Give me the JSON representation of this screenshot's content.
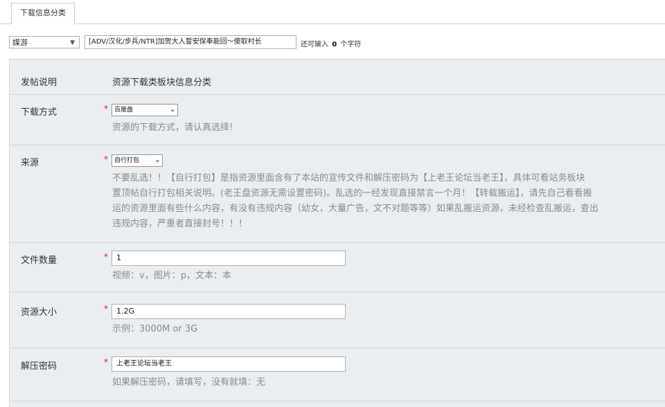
{
  "tabs": {
    "active": "下载信息分类"
  },
  "subject": {
    "type_select": "媒游",
    "title_value": "[ADV/汉化/步兵/NTR]加贺大人誓安保奉能回～傻取村长",
    "char_hint_prefix": "还可输入",
    "char_count": "0",
    "char_hint_suffix": "个字符"
  },
  "form": {
    "note": {
      "label": "发帖说明",
      "value": "资源下载类板块信息分类"
    },
    "download_method": {
      "label": "下载方式",
      "required": "*",
      "selected": "百度盘",
      "help": "资源的下载方式，请认真选择!"
    },
    "source": {
      "label": "来源",
      "required": "*",
      "selected": "自行打包",
      "help_lines": [
        "不要乱选！！【自行打包】是指资源里面含有了本站的宣传文件和解压密码为【上老王论坛当老王】，具体可看站务板块",
        "置顶帖自行打包相关说明。(老王盘资源无需设置密码)。乱选的一经发现直接禁言一个月！【转载搬运】，请先自己看看搬",
        "运的资源里面有些什么内容，有没有违规内容（幼女，大量广告，文不对题等等）如果乱搬运资源，未经检查乱搬运，查出",
        "违规内容，严重者直接封号！！！"
      ]
    },
    "file_count": {
      "label": "文件数量",
      "required": "*",
      "value": "1",
      "help": "视频：v，图片：p，文本：本"
    },
    "resource_size": {
      "label": "资源大小",
      "required": "*",
      "value": "1.2G",
      "help": "示例：3000M or 3G"
    },
    "unzip_password": {
      "label": "解压密码",
      "required": "*",
      "value": "上老王论坛当老王",
      "help": "如果解压密码，请填写，没有就填：无"
    }
  }
}
